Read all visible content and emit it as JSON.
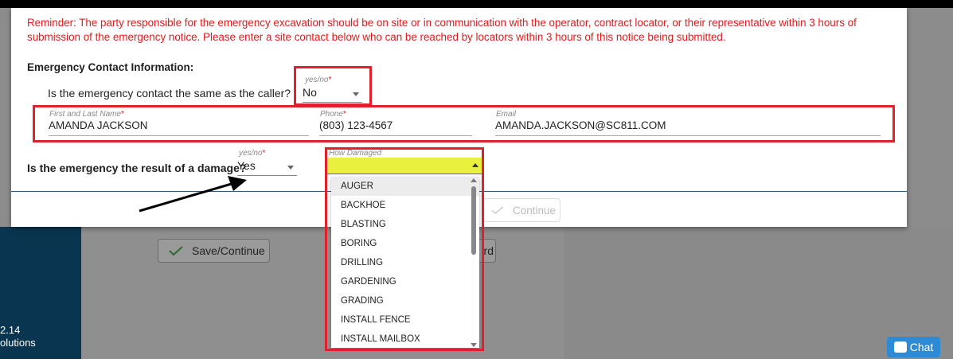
{
  "reminder": "Reminder: The party responsible for the emergency excavation should be on site or in communication with the operator, contract locator, or their representative within 3 hours of submission of the emergency notice. Please enter a site contact below who can be reached by locators within 3 hours of this notice being submitted.",
  "section_title": "Emergency Contact Information:",
  "same_as_caller": {
    "question": "Is the emergency contact the same as the caller?",
    "label": "yes/no",
    "value": "No"
  },
  "contact": {
    "name_label": "First and Last Name",
    "name_value": "AMANDA JACKSON",
    "phone_label": "Phone",
    "phone_value": "(803) 123-4567",
    "email_label": "Email",
    "email_value": "AMANDA.JACKSON@SC811.COM"
  },
  "damage": {
    "question": "Is the emergency the result of a damage?",
    "label": "yes/no",
    "value": "Yes",
    "how_label": "How Damaged",
    "how_value": "",
    "options": [
      "AUGER",
      "BACKHOE",
      "BLASTING",
      "BORING",
      "DRILLING",
      "GARDENING",
      "GRADING",
      "INSTALL FENCE",
      "INSTALL MAILBOX"
    ]
  },
  "required_mark": "*",
  "continue_label": "Continue",
  "background": {
    "save_continue": "Save/Continue",
    "back_fragment": "rd",
    "version": "2.14",
    "company_fragment": "olutions"
  },
  "chat_label": "Chat",
  "colors": {
    "reminder_red": "#e21b1b",
    "highlight_box": "#e0202a",
    "dropdown_yellow": "#e9f03d",
    "sidebar": "#0a3550",
    "chat_blue": "#2d8bd6"
  }
}
